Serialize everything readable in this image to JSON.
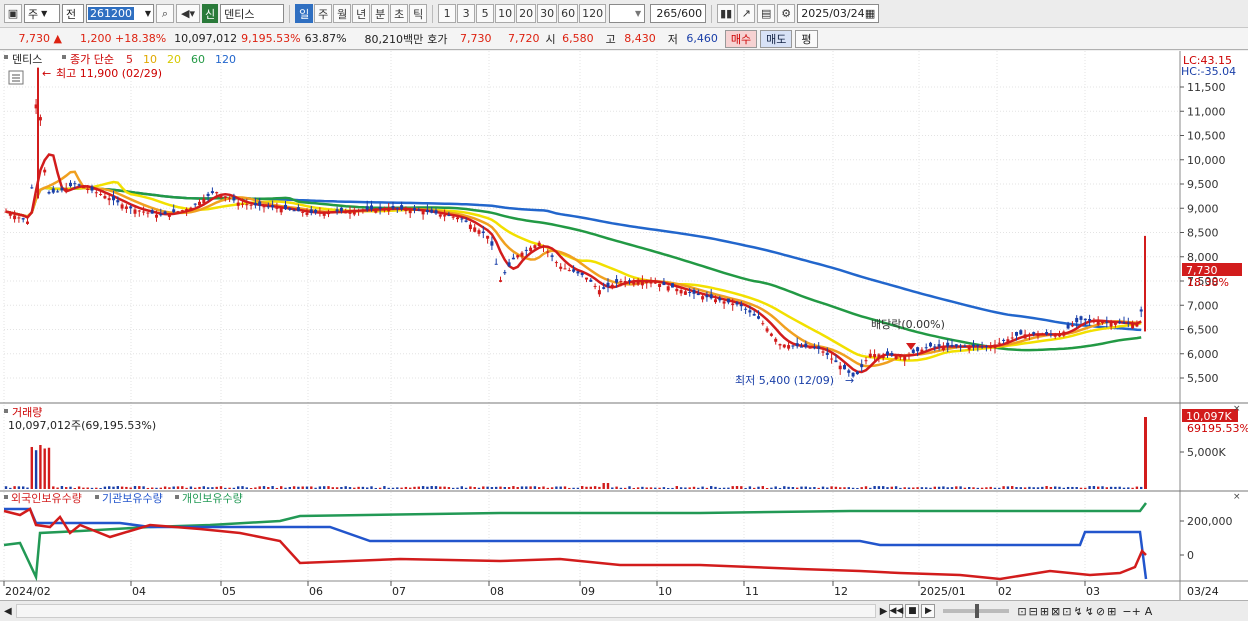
{
  "toolbar": {
    "market": "주",
    "prev_label": "전",
    "code": "261200",
    "credit_badge": "신",
    "stock_name": "덴티스",
    "period_tabs": [
      "일",
      "주",
      "월",
      "년",
      "분",
      "초",
      "틱"
    ],
    "active_period": "일",
    "interval_buttons": [
      "1",
      "3",
      "5",
      "10",
      "20",
      "30",
      "60",
      "120"
    ],
    "count": "265",
    "count_max": "/600",
    "date": "2025/03/24"
  },
  "quote": {
    "price": "7,730",
    "arrow": "▲",
    "change": "1,200",
    "change_pct": "+18.38%",
    "volume": "10,097,012",
    "volume_pct": "9,195.53%",
    "turnover_pct": "63.87%",
    "amount": "80,210백만",
    "hoga_label": "호가",
    "ask": "7,730",
    "bid": "7,720",
    "open_label": "시",
    "open": "6,580",
    "high_label": "고",
    "high": "8,430",
    "low_label": "저",
    "low": "6,460",
    "buy_label": "매수",
    "sell_label": "매도",
    "eval_label": "평"
  },
  "price_panel": {
    "title": "덴티스",
    "legend_prefix": "종가 단순",
    "ma_legend": [
      {
        "label": "5",
        "color": "#d21c1c"
      },
      {
        "label": "10",
        "color": "#e0a800"
      },
      {
        "label": "20",
        "color": "#d4c900"
      },
      {
        "label": "60",
        "color": "#229944"
      },
      {
        "label": "120",
        "color": "#2266cc"
      }
    ],
    "lc": "LC:43.15",
    "hc": "HC:-35.04",
    "high_note": "최고 11,900 (02/29)",
    "low_note": "최저 5,400 (12/09)",
    "dividend_note": "배당락(0.00%)",
    "current_price_tag": "7,730",
    "current_pct_tag": "18.38%",
    "yaxis_labels": [
      "11,500",
      "11,000",
      "10,500",
      "10,000",
      "9,500",
      "9,000",
      "8,500",
      "8,000",
      "7,500",
      "7,000",
      "6,500",
      "6,000",
      "5,500"
    ]
  },
  "volume_panel": {
    "title": "거래량",
    "subtitle": "10,097,012주(69,195.53%)",
    "tag_value": "10,097K",
    "tag_pct": "69195.53%",
    "yaxis_label": "5,000K"
  },
  "holder_panel": {
    "legend": [
      {
        "label": "외국인보유수량",
        "color": "#d21c1c"
      },
      {
        "label": "기관보유수량",
        "color": "#2255cc"
      },
      {
        "label": "개인보유수량",
        "color": "#229955"
      }
    ],
    "yaxis_labels": [
      "200,000",
      "0"
    ]
  },
  "xaxis_labels": [
    "2024/02",
    "04",
    "05",
    "06",
    "07",
    "08",
    "09",
    "10",
    "11",
    "12",
    "2025/01",
    "02",
    "03"
  ],
  "xaxis_last": "03/24",
  "colors": {
    "up": "#d21c1c",
    "down": "#1a3fa8",
    "ma5": "#d21c1c",
    "ma10": "#f0a020",
    "ma20": "#f2e000",
    "ma60": "#229944",
    "ma120": "#2266cc"
  }
}
